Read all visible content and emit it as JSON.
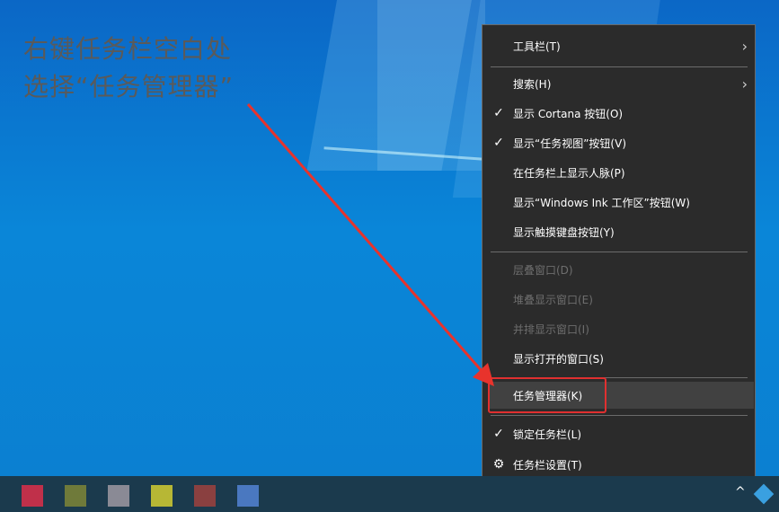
{
  "annotation": {
    "line1": "右键任务栏空白处",
    "line2": "选择“任务管理器”"
  },
  "colors": {
    "annotation_arrow": "#e8332c",
    "highlight_box": "#e03030",
    "menu_bg": "#2b2b2b",
    "desktop_blue": "#0a86d8"
  },
  "context_menu": {
    "items": [
      {
        "label": "工具栏(T)",
        "checked": false,
        "submenu": true,
        "disabled": false
      },
      {
        "label": "搜索(H)",
        "checked": false,
        "submenu": true,
        "disabled": false
      },
      {
        "label": "显示 Cortana 按钮(O)",
        "checked": true,
        "submenu": false,
        "disabled": false
      },
      {
        "label": "显示“任务视图”按钮(V)",
        "checked": true,
        "submenu": false,
        "disabled": false
      },
      {
        "label": "在任务栏上显示人脉(P)",
        "checked": false,
        "submenu": false,
        "disabled": false
      },
      {
        "label": "显示“Windows Ink 工作区”按钮(W)",
        "checked": false,
        "submenu": false,
        "disabled": false
      },
      {
        "label": "显示触摸键盘按钮(Y)",
        "checked": false,
        "submenu": false,
        "disabled": false
      },
      {
        "label": "层叠窗口(D)",
        "checked": false,
        "submenu": false,
        "disabled": true
      },
      {
        "label": "堆叠显示窗口(E)",
        "checked": false,
        "submenu": false,
        "disabled": true
      },
      {
        "label": "并排显示窗口(I)",
        "checked": false,
        "submenu": false,
        "disabled": true
      },
      {
        "label": "显示打开的窗口(S)",
        "checked": false,
        "submenu": false,
        "disabled": false
      },
      {
        "label": "任务管理器(K)",
        "checked": false,
        "submenu": false,
        "disabled": false,
        "highlighted": true
      },
      {
        "label": "锁定任务栏(L)",
        "checked": true,
        "submenu": false,
        "disabled": false
      },
      {
        "label": "任务栏设置(T)",
        "checked": false,
        "submenu": false,
        "disabled": false,
        "icon": "gear-icon"
      }
    ],
    "check_glyph": "✓",
    "submenu_glyph": "›",
    "settings_glyph": "⚙"
  },
  "taskbar": {
    "icons": [
      {
        "name": "app-icon-1",
        "color": "#c0304a"
      },
      {
        "name": "app-icon-2",
        "color": "#6f7a3a"
      },
      {
        "name": "app-icon-3",
        "color": "#8a8a95"
      },
      {
        "name": "app-icon-4",
        "color": "#b7b735"
      },
      {
        "name": "app-icon-5",
        "color": "#8a4040"
      },
      {
        "name": "app-icon-6",
        "color": "#4a78c0"
      }
    ],
    "tray_chevron": "^"
  }
}
